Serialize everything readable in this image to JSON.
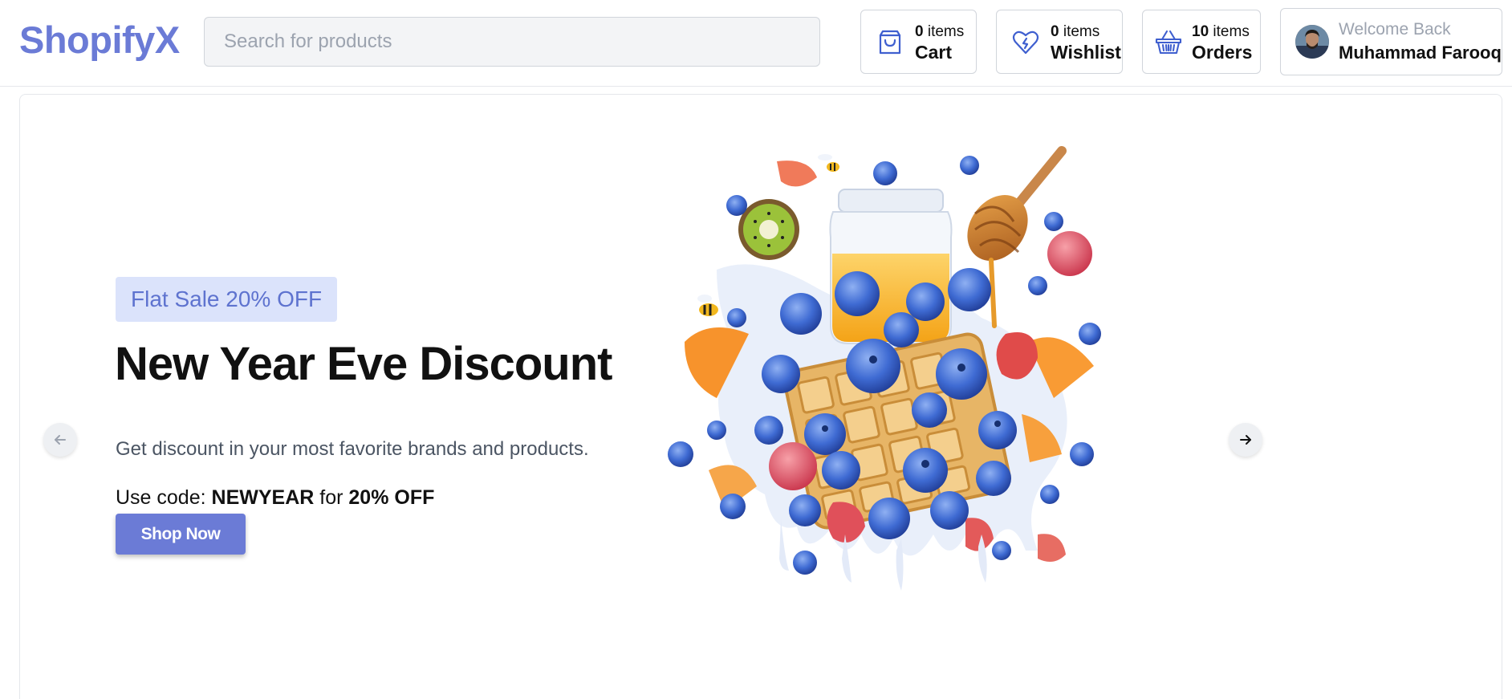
{
  "brand": {
    "logo": "ShopifyX",
    "accent_color": "#6b7bd6"
  },
  "search": {
    "placeholder": "Search for products",
    "value": "",
    "icon": "none"
  },
  "header": {
    "cart": {
      "count": "0",
      "count_suffix": " items",
      "label": "Cart",
      "icon": "shopping-bag-icon"
    },
    "wishlist": {
      "count": "0",
      "count_suffix": " items",
      "label": "Wishlist",
      "icon": "heart-icon"
    },
    "orders": {
      "count": "10",
      "count_suffix": " items",
      "label": "Orders",
      "icon": "basket-icon"
    },
    "user": {
      "greeting": "Welcome Back",
      "name": "Muhammad Farooq",
      "avatar_icon": "user-avatar"
    }
  },
  "hero": {
    "badge": "Flat Sale 20% OFF",
    "title": "New Year Eve Discount",
    "subtitle": "Get discount in your most favorite brands and products.",
    "code_prefix": "Use code: ",
    "code": "NEWYEAR",
    "code_middle": " for ",
    "discount": "20% OFF",
    "button": "Shop Now",
    "image_subject": "waffles, blueberries, raspberries, strawberries, kiwi, orange slices, honey dipper, juice jar and splashing milk",
    "prev_icon": "arrow-left-icon",
    "next_icon": "arrow-right-icon"
  }
}
